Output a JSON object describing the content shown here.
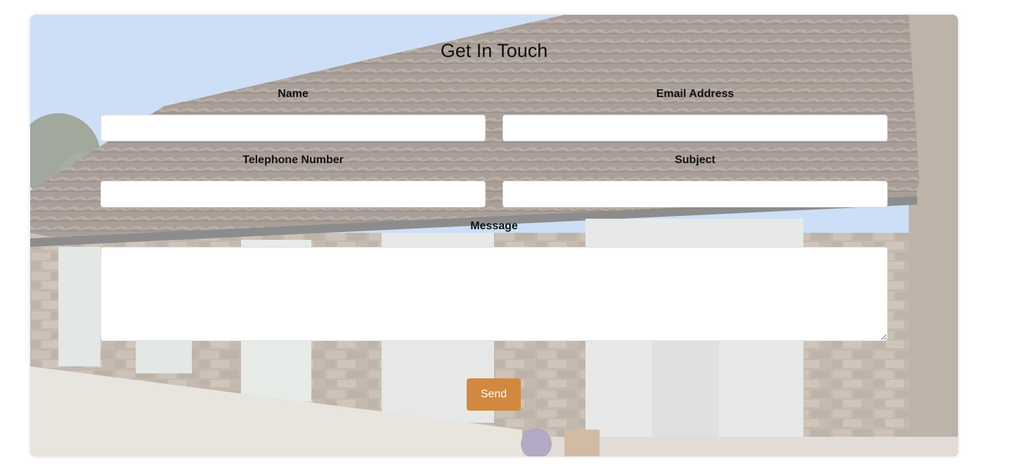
{
  "form": {
    "title": "Get In Touch",
    "name_label": "Name",
    "email_label": "Email Address",
    "telephone_label": "Telephone Number",
    "subject_label": "Subject",
    "message_label": "Message",
    "name_value": "",
    "email_value": "",
    "telephone_value": "",
    "subject_value": "",
    "message_value": "",
    "send_label": "Send"
  },
  "colors": {
    "send_button": "#d2883f",
    "field_background": "#ffffff",
    "sky": "#a9c9ef",
    "roof": "#6e5a4c",
    "stone": "#9a8a78"
  },
  "background_image": "stone-barn-photo"
}
